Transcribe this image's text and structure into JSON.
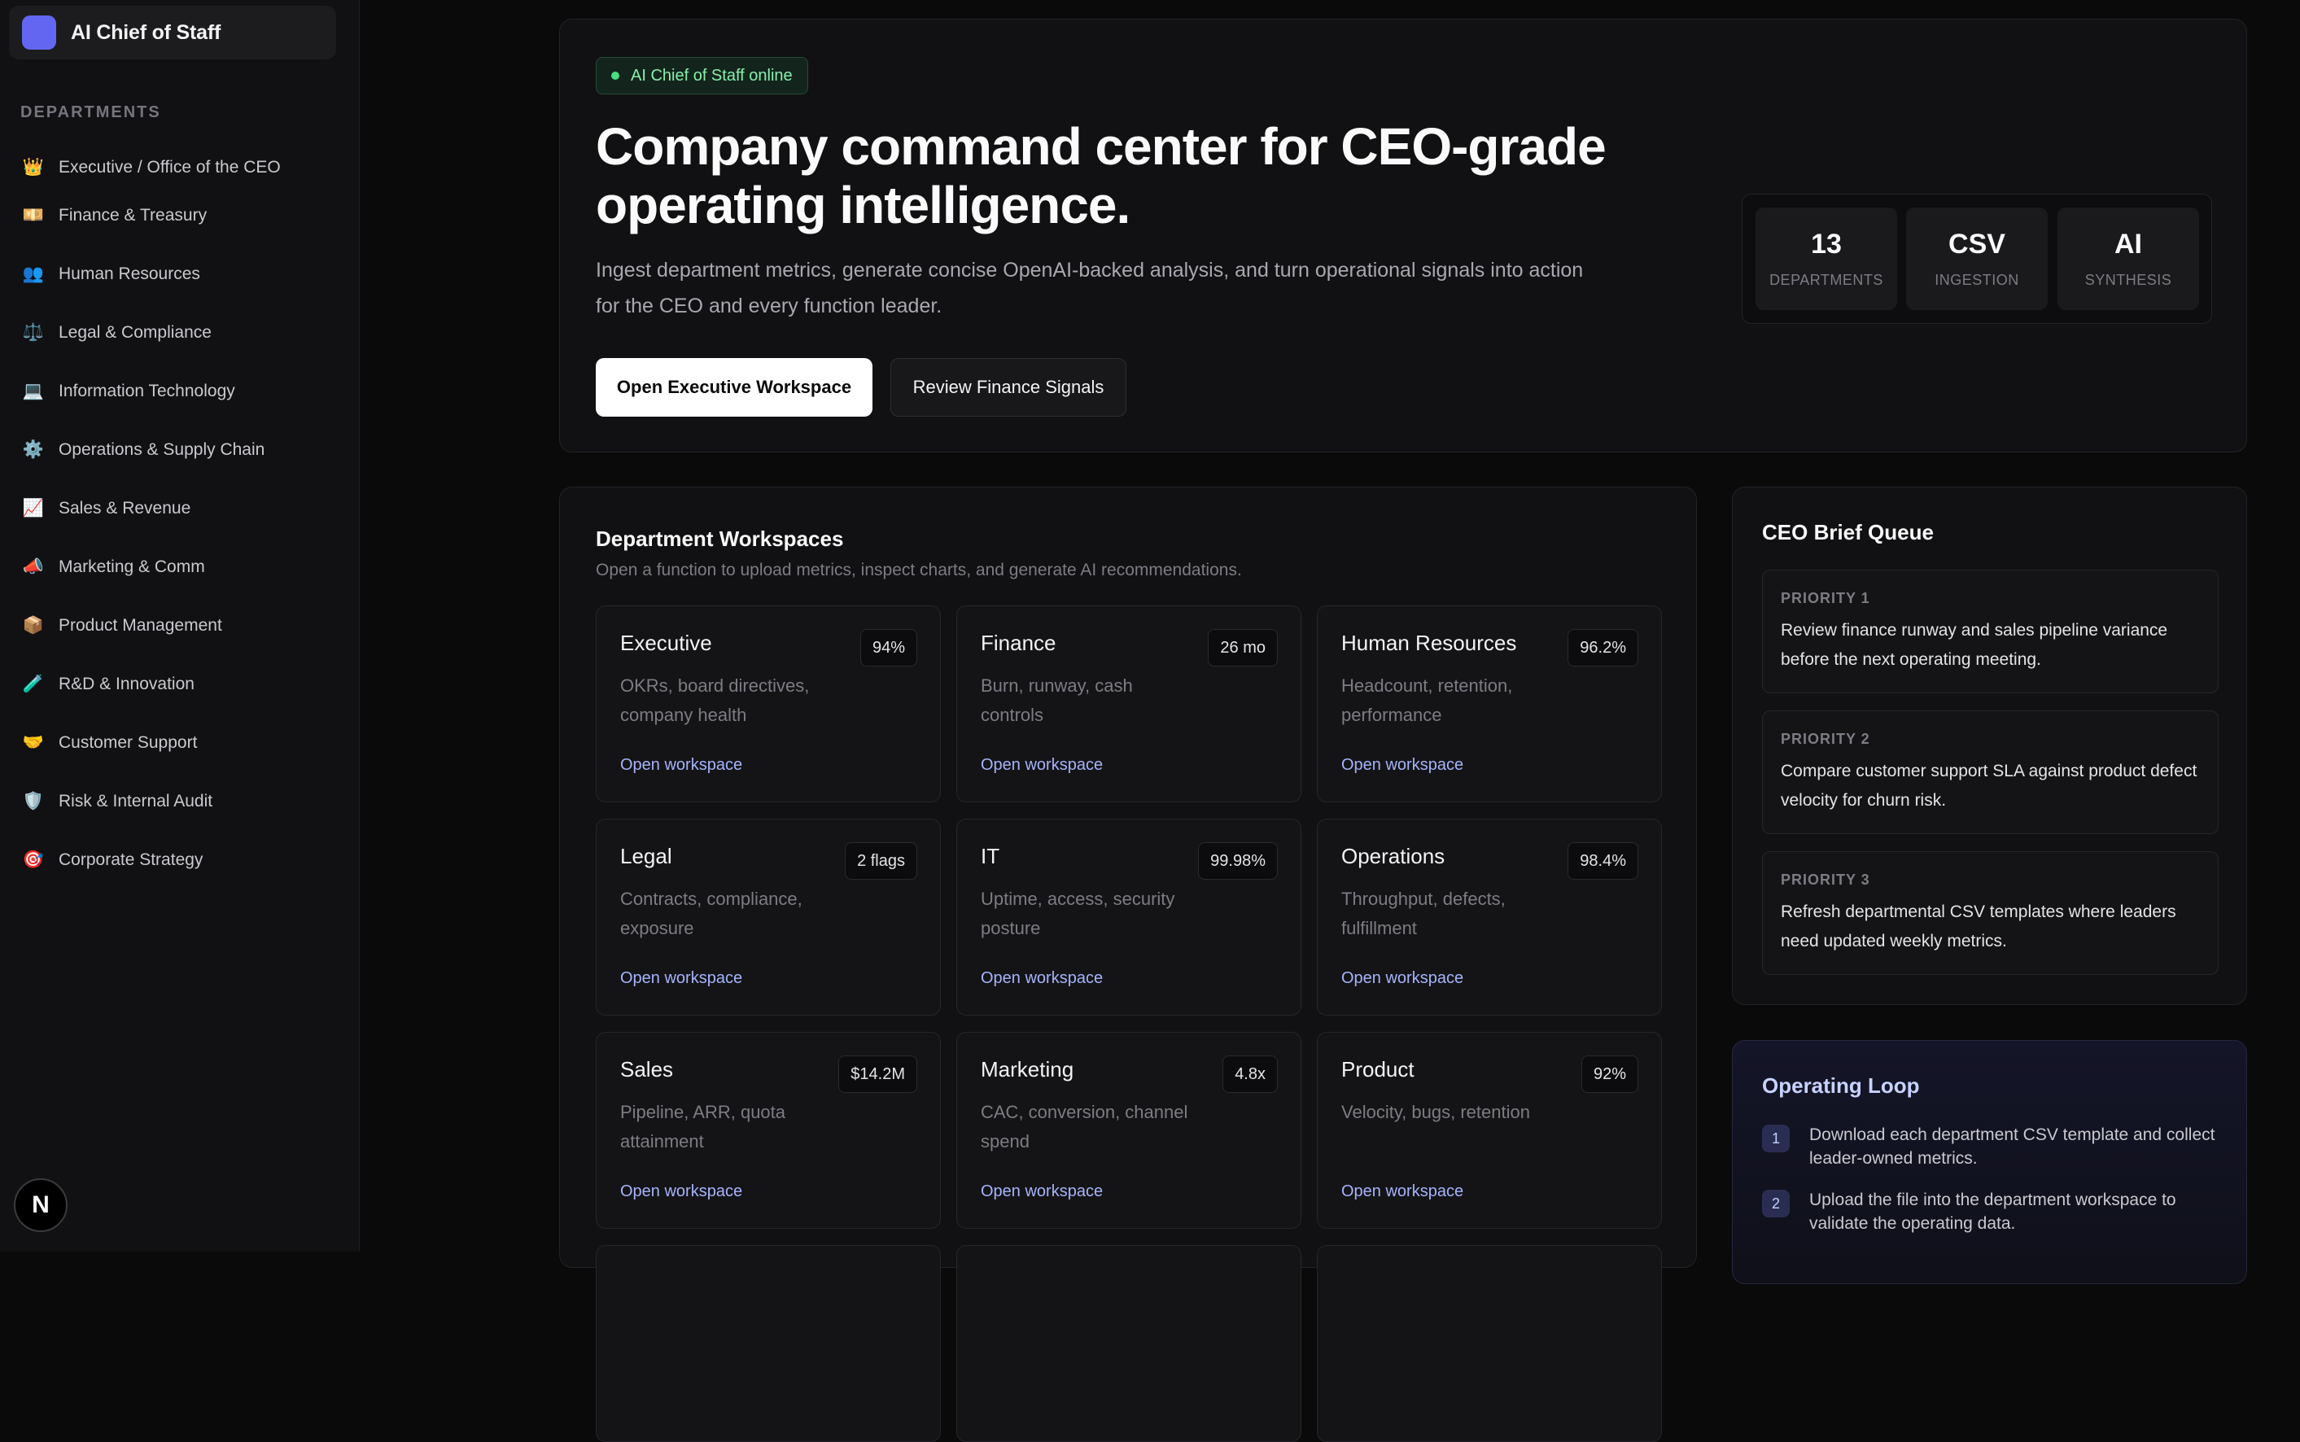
{
  "brand": {
    "title": "AI Chief of Staff"
  },
  "sidebar": {
    "heading": "DEPARTMENTS",
    "items": [
      {
        "icon": "👑",
        "icon_name": "crown-icon",
        "label": "Executive / Office of the CEO"
      },
      {
        "icon": "💴",
        "icon_name": "banknote-icon",
        "label": "Finance & Treasury"
      },
      {
        "icon": "👥",
        "icon_name": "people-icon",
        "label": "Human Resources"
      },
      {
        "icon": "⚖️",
        "icon_name": "scales-icon",
        "label": "Legal & Compliance"
      },
      {
        "icon": "💻",
        "icon_name": "laptop-icon",
        "label": "Information Technology"
      },
      {
        "icon": "⚙️",
        "icon_name": "gear-icon",
        "label": "Operations & Supply Chain"
      },
      {
        "icon": "📈",
        "icon_name": "chart-up-icon",
        "label": "Sales & Revenue"
      },
      {
        "icon": "📣",
        "icon_name": "megaphone-icon",
        "label": "Marketing & Comm"
      },
      {
        "icon": "📦",
        "icon_name": "package-icon",
        "label": "Product Management"
      },
      {
        "icon": "🧪",
        "icon_name": "test-tube-icon",
        "label": "R&D & Innovation"
      },
      {
        "icon": "🤝",
        "icon_name": "handshake-icon",
        "label": "Customer Support"
      },
      {
        "icon": "🛡️",
        "icon_name": "shield-icon",
        "label": "Risk & Internal Audit"
      },
      {
        "icon": "🎯",
        "icon_name": "target-icon",
        "label": "Corporate Strategy"
      }
    ],
    "badge": "N"
  },
  "hero": {
    "status": "AI Chief of Staff online",
    "title": "Company command center for CEO-grade operating intelligence.",
    "description": "Ingest department metrics, generate concise OpenAI-backed analysis, and turn operational signals into action for the CEO and every function leader.",
    "primary_button": "Open Executive Workspace",
    "secondary_button": "Review Finance Signals",
    "stats": [
      {
        "value": "13",
        "label": "DEPARTMENTS"
      },
      {
        "value": "CSV",
        "label": "INGESTION"
      },
      {
        "value": "AI",
        "label": "SYNTHESIS"
      }
    ]
  },
  "workspaces": {
    "title": "Department Workspaces",
    "subtitle": "Open a function to upload metrics, inspect charts, and generate AI recommendations.",
    "link_label": "Open workspace",
    "cards": [
      {
        "name": "Executive",
        "badge": "94%",
        "desc": "OKRs, board directives, company health"
      },
      {
        "name": "Finance",
        "badge": "26 mo",
        "desc": "Burn, runway, cash controls"
      },
      {
        "name": "Human Resources",
        "badge": "96.2%",
        "desc": "Headcount, retention, performance"
      },
      {
        "name": "Legal",
        "badge": "2 flags",
        "desc": "Contracts, compliance, exposure"
      },
      {
        "name": "IT",
        "badge": "99.98%",
        "desc": "Uptime, access, security posture"
      },
      {
        "name": "Operations",
        "badge": "98.4%",
        "desc": "Throughput, defects, fulfillment"
      },
      {
        "name": "Sales",
        "badge": "$14.2M",
        "desc": "Pipeline, ARR, quota attainment"
      },
      {
        "name": "Marketing",
        "badge": "4.8x",
        "desc": "CAC, conversion, channel spend"
      },
      {
        "name": "Product",
        "badge": "92%",
        "desc": "Velocity, bugs, retention"
      }
    ]
  },
  "brief": {
    "title": "CEO Brief Queue",
    "items": [
      {
        "label": "PRIORITY 1",
        "text": "Review finance runway and sales pipeline variance before the next operating meeting."
      },
      {
        "label": "PRIORITY 2",
        "text": "Compare customer support SLA against product defect velocity for churn risk."
      },
      {
        "label": "PRIORITY 3",
        "text": "Refresh departmental CSV templates where leaders need updated weekly metrics."
      }
    ]
  },
  "loop": {
    "title": "Operating Loop",
    "steps": [
      {
        "num": "1",
        "text": "Download each department CSV template and collect leader-owned metrics."
      },
      {
        "num": "2",
        "text": "Upload the file into the department workspace to validate the operating data."
      }
    ]
  }
}
